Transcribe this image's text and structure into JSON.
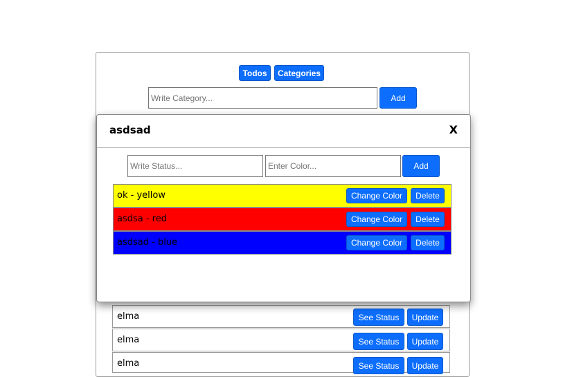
{
  "nav": {
    "todos_label": "Todos",
    "categories_label": "Categories"
  },
  "category_form": {
    "placeholder": "Write Category...",
    "add_label": "Add"
  },
  "categories": [
    {
      "name": "elma",
      "see_status_label": "See Status",
      "update_label": "Update"
    },
    {
      "name": "elma",
      "see_status_label": "See Status",
      "update_label": "Update"
    },
    {
      "name": "elma",
      "see_status_label": "See Status",
      "update_label": "Update"
    }
  ],
  "modal": {
    "title": "asdsad",
    "close_label": "X",
    "status_placeholder": "Write Status...",
    "color_placeholder": "Enter Color...",
    "add_label": "Add",
    "statuses": [
      {
        "label": "ok - yellow",
        "color": "#ffff00",
        "change_color_label": "Change Color",
        "delete_label": "Delete"
      },
      {
        "label": "asdsa - red",
        "color": "#ff0000",
        "change_color_label": "Change Color",
        "delete_label": "Delete"
      },
      {
        "label": "asdsad - blue",
        "color": "#0000ff",
        "change_color_label": "Change Color",
        "delete_label": "Delete"
      }
    ]
  },
  "colors": {
    "button_primary": "#0d6efd"
  }
}
